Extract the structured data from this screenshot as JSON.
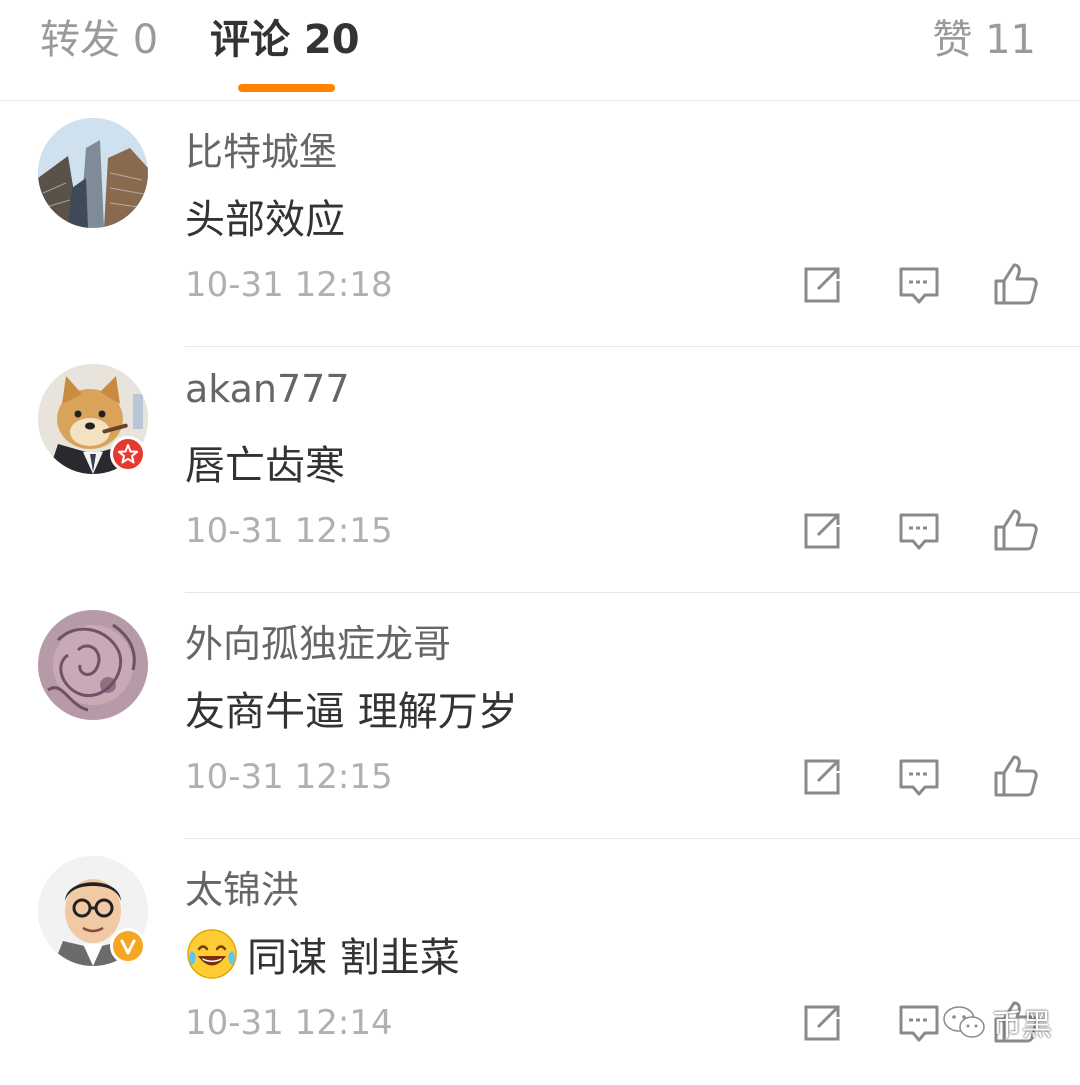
{
  "tabs": {
    "repost": "转发 0",
    "comments": "评论 20",
    "likes": "赞 11"
  },
  "accent_color": "#ff8200",
  "comments": [
    {
      "username": "比特城堡",
      "content": "头部效应",
      "time": "10-31 12:18",
      "avatar": "city-buildings-avatar",
      "badge": null
    },
    {
      "username": "akan777",
      "content": "唇亡齿寒",
      "time": "10-31 12:15",
      "avatar": "doge-suit-avatar",
      "badge": "red-star-badge"
    },
    {
      "username": "外向孤独症龙哥",
      "content": "友商牛逼 理解万岁",
      "time": "10-31 12:15",
      "avatar": "purple-art-avatar",
      "badge": null
    },
    {
      "username": "太锦洪",
      "content": "同谋 割韭菜",
      "time": "10-31 12:14",
      "avatar": "cartoon-man-avatar",
      "badge": "orange-v-badge",
      "emoji": "laughing-tears-emoji"
    }
  ],
  "watermark": "币黑"
}
